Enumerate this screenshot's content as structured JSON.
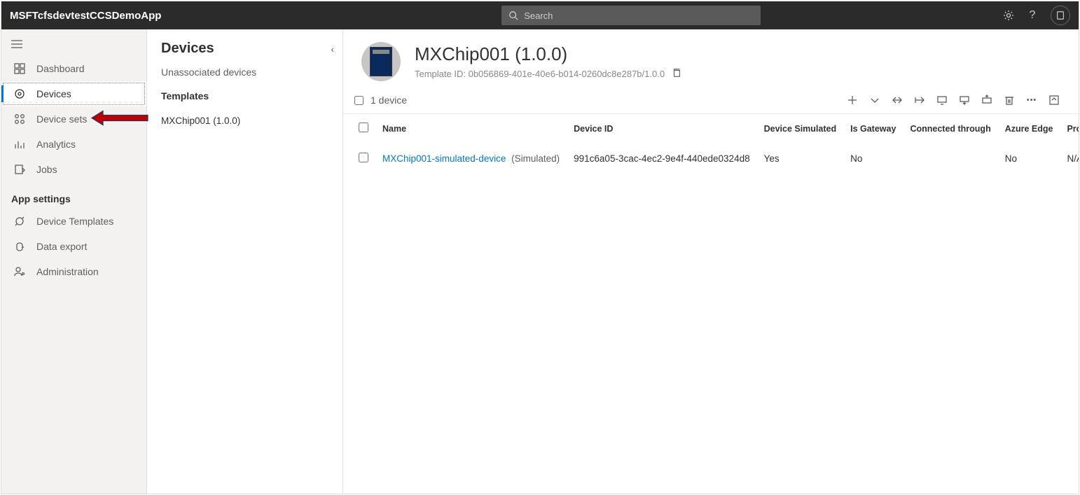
{
  "topbar": {
    "app_title": "MSFTcfsdevtestCCSDemoApp",
    "search_placeholder": "Search"
  },
  "leftnav": {
    "items": [
      {
        "key": "dashboard",
        "label": "Dashboard"
      },
      {
        "key": "devices",
        "label": "Devices"
      },
      {
        "key": "device-sets",
        "label": "Device sets"
      },
      {
        "key": "analytics",
        "label": "Analytics"
      },
      {
        "key": "jobs",
        "label": "Jobs"
      }
    ],
    "section_label": "App settings",
    "settings_items": [
      {
        "key": "device-templates",
        "label": "Device Templates"
      },
      {
        "key": "data-export",
        "label": "Data export"
      },
      {
        "key": "administration",
        "label": "Administration"
      }
    ]
  },
  "secondary": {
    "heading": "Devices",
    "unassociated": "Unassociated devices",
    "templates_heading": "Templates",
    "template_item": "MXChip001 (1.0.0)"
  },
  "device_header": {
    "title": "MXChip001 (1.0.0)",
    "template_id_label": "Template ID: 0b056869-401e-40e6-b014-0260dc8e287b/1.0.0"
  },
  "toolbar": {
    "count_label": "1 device"
  },
  "grid": {
    "columns": [
      "Name",
      "Device ID",
      "Device Simulated",
      "Is Gateway",
      "Connected through",
      "Azure Edge",
      "Provisioning Stat"
    ],
    "rows": [
      {
        "name": "MXChip001-simulated-device",
        "sim_tag": "(Simulated)",
        "device_id": "991c6a05-3cac-4ec2-9e4f-440ede0324d8",
        "simulated": "Yes",
        "is_gateway": "No",
        "connected_through": "",
        "azure_edge": "No",
        "provisioning": "N/A"
      }
    ]
  }
}
